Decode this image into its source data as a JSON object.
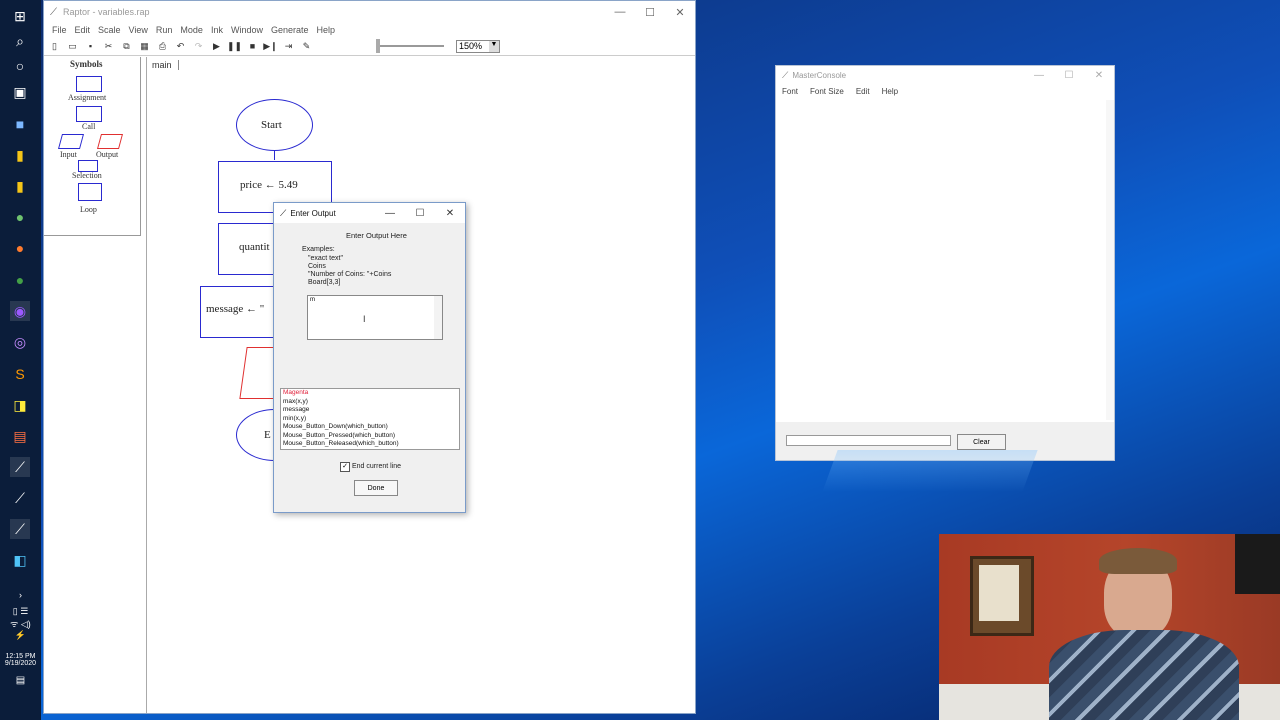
{
  "raptor": {
    "title": "Raptor - variables.rap",
    "menu": [
      "File",
      "Edit",
      "Scale",
      "View",
      "Run",
      "Mode",
      "Ink",
      "Window",
      "Generate",
      "Help"
    ],
    "zoom": "150%",
    "symbols_header": "Symbols",
    "symbols": {
      "assignment": "Assignment",
      "call": "Call",
      "input": "Input",
      "output": "Output",
      "selection": "Selection",
      "loop": "Loop"
    },
    "tab": "main",
    "flow": {
      "start": "Start",
      "step1": "price ← 5.49",
      "step2": "quantit",
      "step3": "message ← \"",
      "end": "E"
    }
  },
  "dialog": {
    "title": "Enter Output",
    "heading": "Enter Output Here",
    "examples_label": "Examples:",
    "examples": [
      "\"exact text\"",
      "Coins",
      "\"Number of Coins: \"+Coins",
      "Board[3,3]"
    ],
    "input_value": "m",
    "suggestions": [
      "Magenta",
      "max(x,y)",
      "message",
      "min(x,y)",
      "Mouse_Button_Down(which_button)",
      "Mouse_Button_Pressed(which_button)",
      "Mouse_Button_Released(which_button)"
    ],
    "checkbox_label": "End current line",
    "checkbox_checked": true,
    "done_label": "Done"
  },
  "console": {
    "title": "MasterConsole",
    "menu": [
      "Font",
      "Font Size",
      "Edit",
      "Help"
    ],
    "clear_label": "Clear"
  },
  "tray": {
    "time": "12:15 PM",
    "date": "9/19/2020"
  },
  "colors": {
    "flow_blue": "#2a2ad0",
    "output_red": "#e03030",
    "suggestion_highlight": "#e0203a"
  }
}
